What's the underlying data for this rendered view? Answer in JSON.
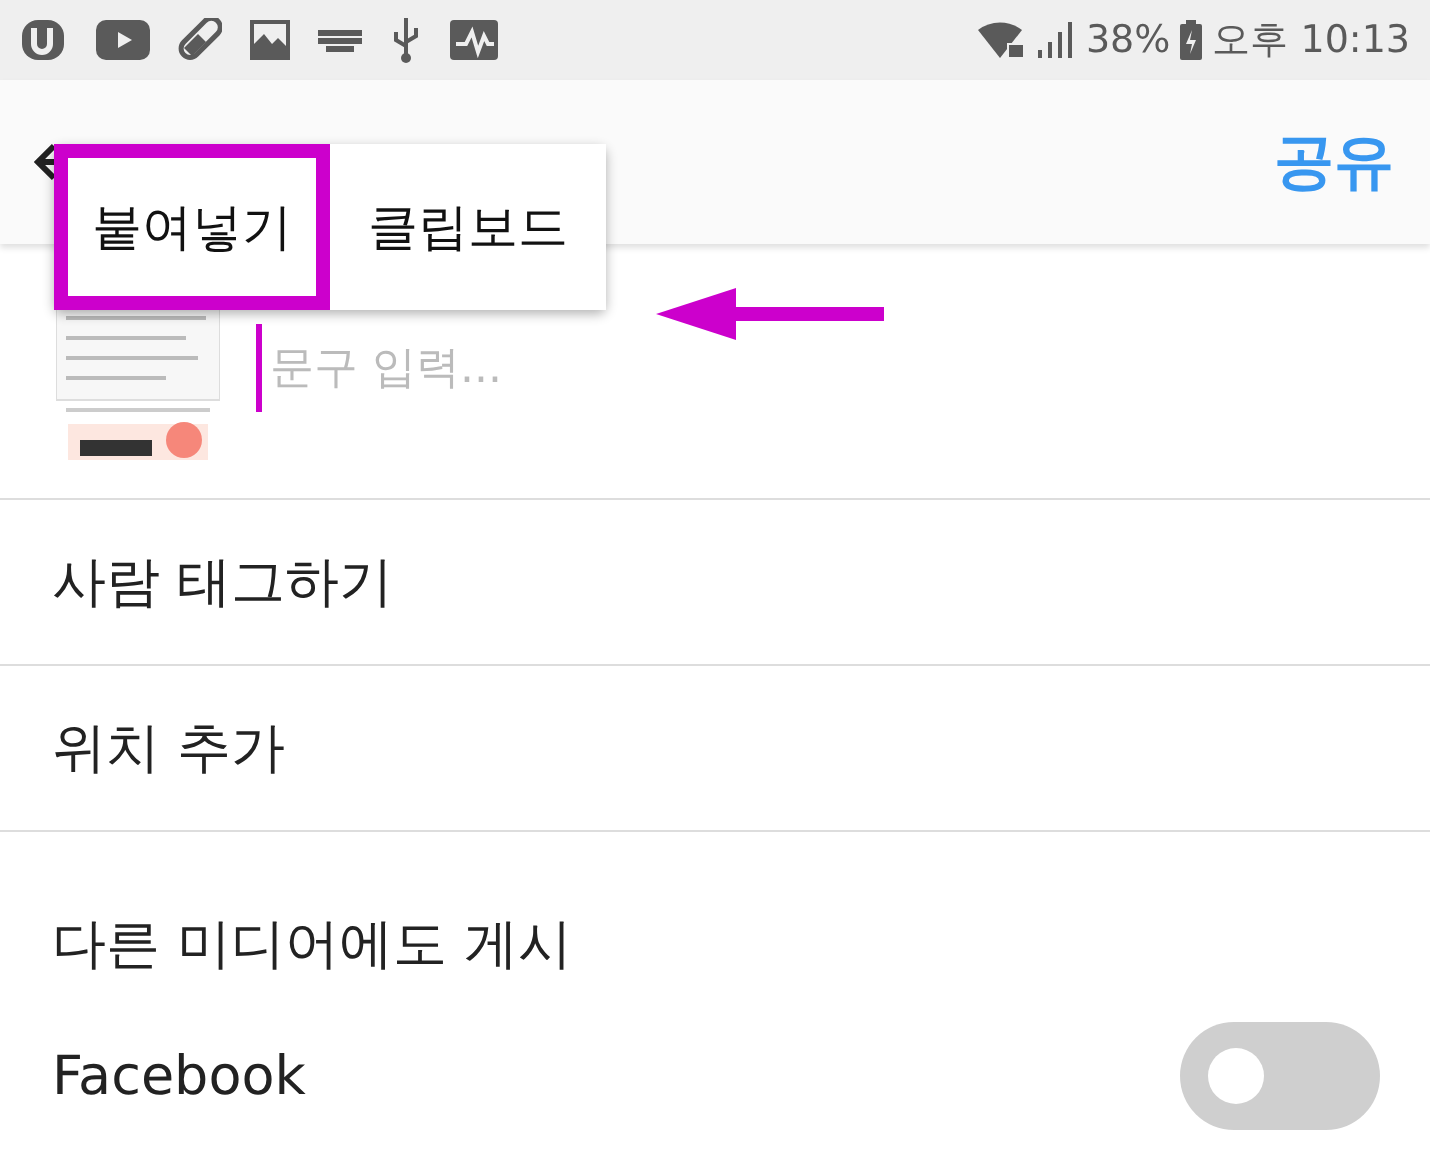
{
  "status_bar": {
    "battery": "38%",
    "time": "오후 10:13"
  },
  "app_bar": {
    "action": "공유"
  },
  "paste_menu": [
    {
      "label": "붙여넣기",
      "highlighted": true
    },
    {
      "label": "클립보드",
      "highlighted": false
    }
  ],
  "caption": {
    "placeholder": "문구 입력..."
  },
  "options": [
    {
      "label": "사람 태그하기"
    },
    {
      "label": "위치 추가"
    }
  ],
  "share_section": {
    "title": "다른 미디어에도 게시",
    "services": [
      {
        "name": "Facebook",
        "on": false
      }
    ]
  }
}
